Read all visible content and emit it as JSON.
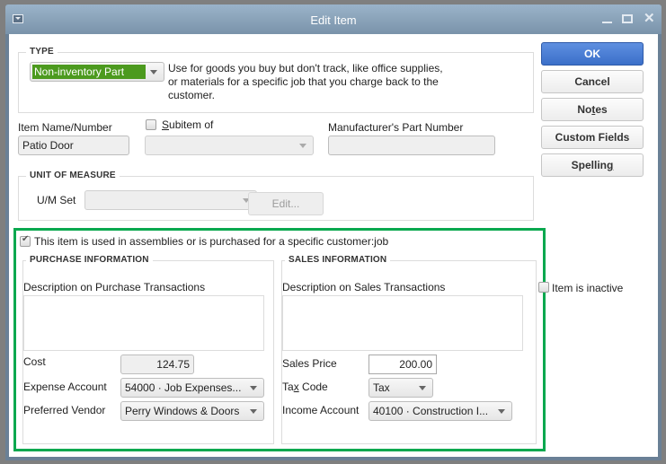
{
  "window": {
    "title": "Edit Item",
    "controls": {
      "minimize": "minimize",
      "maximize": "maximize",
      "close": "✕"
    }
  },
  "type": {
    "group_label": "TYPE",
    "selected": "Non-inventory Part",
    "selected_bg_color": "#4c9a1e",
    "description": "Use for goods you buy but don't track, like office supplies, or materials for a specific job that you charge back to the customer."
  },
  "buttons": {
    "ok": "OK",
    "cancel": "Cancel",
    "notes_pre": "No",
    "notes_u": "t",
    "notes_post": "es",
    "custom_fields": "Custom Fields",
    "spelling_pre": "Spellin",
    "spelling_u": "g",
    "primary_color": "#3b6fc9"
  },
  "item": {
    "name_label": "Item Name/Number",
    "name_value": "Patio Door",
    "subitem_checked": false,
    "subitem_label_u": "S",
    "subitem_label_rest": "ubitem of",
    "subitem_value": "",
    "mfr_label": "Manufacturer's Part Number",
    "mfr_value": ""
  },
  "uom": {
    "group_label": "UNIT OF MEASURE",
    "set_label": "U/M Set",
    "set_value": "",
    "edit_label": "Edit..."
  },
  "assembly": {
    "checked": true,
    "label": "This item is used in assemblies or is purchased for a specific customer:job",
    "highlight_color": "#0aa84f"
  },
  "purchase": {
    "group_label": "PURCHASE INFORMATION",
    "desc_label": "Description on Purchase Transactions",
    "desc_value": "",
    "cost_label": "Cost",
    "cost_value": "124.75",
    "expense_label": "Expense Account",
    "expense_value": "54000 · Job Expenses...",
    "vendor_label": "Preferred Vendor",
    "vendor_value": "Perry Windows & Doors"
  },
  "sales": {
    "group_label": "SALES INFORMATION",
    "desc_label": "Description on Sales Transactions",
    "desc_value": "",
    "price_label": "Sales Price",
    "price_value": "200.00",
    "tax_label_pre": "Ta",
    "tax_label_u": "x",
    "tax_label_post": " Code",
    "tax_value": "Tax",
    "income_label": "Income Account",
    "income_value": "40100 · Construction I..."
  },
  "inactive": {
    "checked": false,
    "label": "Item is inactive"
  }
}
